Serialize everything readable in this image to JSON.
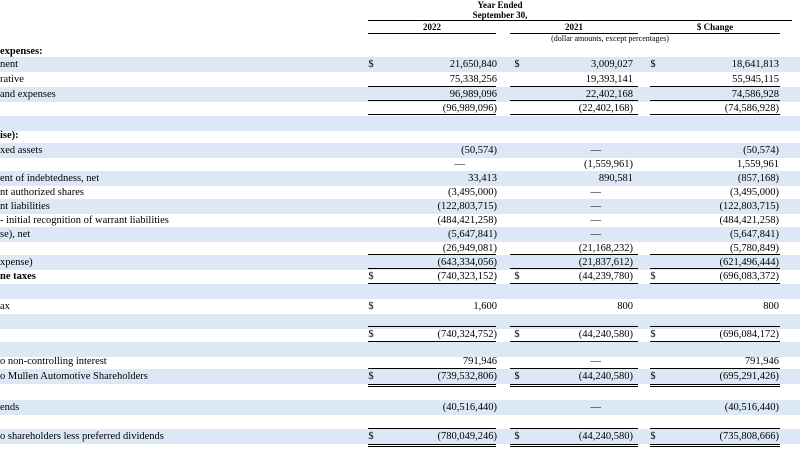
{
  "header": {
    "period": "Year Ended\nSeptember 30,",
    "col_2022": "2022",
    "col_2021": "2021",
    "col_change": "$ Change",
    "units_note": "(dollar amounts, except percentages)"
  },
  "rows": [
    {
      "label": "expenses:",
      "bold": true,
      "band": false,
      "v": [
        "",
        "",
        ""
      ],
      "d": [
        false,
        false,
        false
      ]
    },
    {
      "label": "nent",
      "band": true,
      "v": [
        "21,650,840",
        "3,009,027",
        "18,641,813"
      ],
      "d": [
        true,
        true,
        true
      ]
    },
    {
      "label": "rative",
      "band": false,
      "v": [
        "75,338,256",
        "19,393,141",
        "55,945,115"
      ],
      "d": [
        false,
        false,
        false
      ]
    },
    {
      "label": "and expenses",
      "band": true,
      "v": [
        "96,989,096",
        "22,402,168",
        "74,586,928"
      ],
      "d": [
        false,
        false,
        false
      ]
    },
    {
      "label": "",
      "band": false,
      "v": [
        "(96,989,096)",
        "(22,402,168)",
        "(74,586,928)"
      ],
      "d": [
        false,
        false,
        false
      ]
    },
    {
      "label": "",
      "band": true,
      "v": [
        "",
        "",
        ""
      ],
      "d": [
        false,
        false,
        false
      ]
    },
    {
      "label": "ise):",
      "bold": true,
      "band": false,
      "v": [
        "",
        "",
        ""
      ],
      "d": [
        false,
        false,
        false
      ]
    },
    {
      "label": "xed assets",
      "band": true,
      "v": [
        "(50,574)",
        "—",
        "(50,574)"
      ],
      "d": [
        false,
        false,
        false
      ]
    },
    {
      "label": "",
      "band": false,
      "v": [
        "—",
        "(1,559,961)",
        "1,559,961"
      ],
      "d": [
        false,
        false,
        false
      ]
    },
    {
      "label": "ent of indebtedness, net",
      "band": true,
      "v": [
        "33,413",
        "890,581",
        "(857,168)"
      ],
      "d": [
        false,
        false,
        false
      ]
    },
    {
      "label": "nt authorized shares",
      "band": false,
      "v": [
        "(3,495,000)",
        "—",
        "(3,495,000)"
      ],
      "d": [
        false,
        false,
        false
      ]
    },
    {
      "label": "nt liabilities",
      "band": true,
      "v": [
        "(122,803,715)",
        "—",
        "(122,803,715)"
      ],
      "d": [
        false,
        false,
        false
      ]
    },
    {
      "label": " - initial recognition of warrant liabilities",
      "band": false,
      "v": [
        "(484,421,258)",
        "—",
        "(484,421,258)"
      ],
      "d": [
        false,
        false,
        false
      ]
    },
    {
      "label": "se), net",
      "band": true,
      "v": [
        "(5,647,841)",
        "—",
        "(5,647,841)"
      ],
      "d": [
        false,
        false,
        false
      ]
    },
    {
      "label": "",
      "band": false,
      "v": [
        "(26,949,081)",
        "(21,168,232)",
        "(5,780,849)"
      ],
      "d": [
        false,
        false,
        false
      ]
    },
    {
      "label": "xpense)",
      "band": true,
      "v": [
        "(643,334,056)",
        "(21,837,612)",
        "(621,496,444)"
      ],
      "d": [
        false,
        false,
        false
      ]
    },
    {
      "label": "ne taxes",
      "bold": true,
      "band": false,
      "v": [
        "(740,323,152)",
        "(44,239,780)",
        "(696,083,372)"
      ],
      "d": [
        true,
        true,
        true
      ]
    },
    {
      "label": "",
      "band": true,
      "v": [
        "",
        "",
        ""
      ],
      "d": [
        false,
        false,
        false
      ]
    },
    {
      "label": "ax",
      "band": false,
      "v": [
        "1,600",
        "800",
        "800"
      ],
      "d": [
        true,
        false,
        false
      ]
    },
    {
      "label": "",
      "band": true,
      "v": [
        "",
        "",
        ""
      ],
      "d": [
        false,
        false,
        false
      ]
    },
    {
      "label": "",
      "band": false,
      "v": [
        "(740,324,752)",
        "(44,240,580)",
        "(696,084,172)"
      ],
      "d": [
        true,
        true,
        true
      ]
    },
    {
      "label": "",
      "band": true,
      "v": [
        "",
        "",
        ""
      ],
      "d": [
        false,
        false,
        false
      ]
    },
    {
      "label": "o non-controlling interest",
      "band": false,
      "v": [
        "791,946",
        "—",
        "791,946"
      ],
      "d": [
        false,
        false,
        false
      ]
    },
    {
      "label": "o Mullen Automotive Shareholders",
      "band": true,
      "v": [
        "(739,532,806)",
        "(44,240,580)",
        "(695,291,426)"
      ],
      "d": [
        true,
        true,
        true
      ]
    },
    {
      "label": "",
      "band": false,
      "v": [
        "",
        "",
        ""
      ],
      "d": [
        false,
        false,
        false
      ]
    },
    {
      "label": "ends",
      "band": true,
      "v": [
        "(40,516,440)",
        "—",
        "(40,516,440)"
      ],
      "d": [
        false,
        false,
        false
      ]
    },
    {
      "label": "",
      "band": false,
      "v": [
        "",
        "",
        ""
      ],
      "d": [
        false,
        false,
        false
      ]
    },
    {
      "label": "o shareholders less preferred dividends",
      "band": true,
      "v": [
        "(780,049,246)",
        "(44,240,580)",
        "(735,808,666)"
      ],
      "d": [
        true,
        true,
        true
      ]
    }
  ]
}
